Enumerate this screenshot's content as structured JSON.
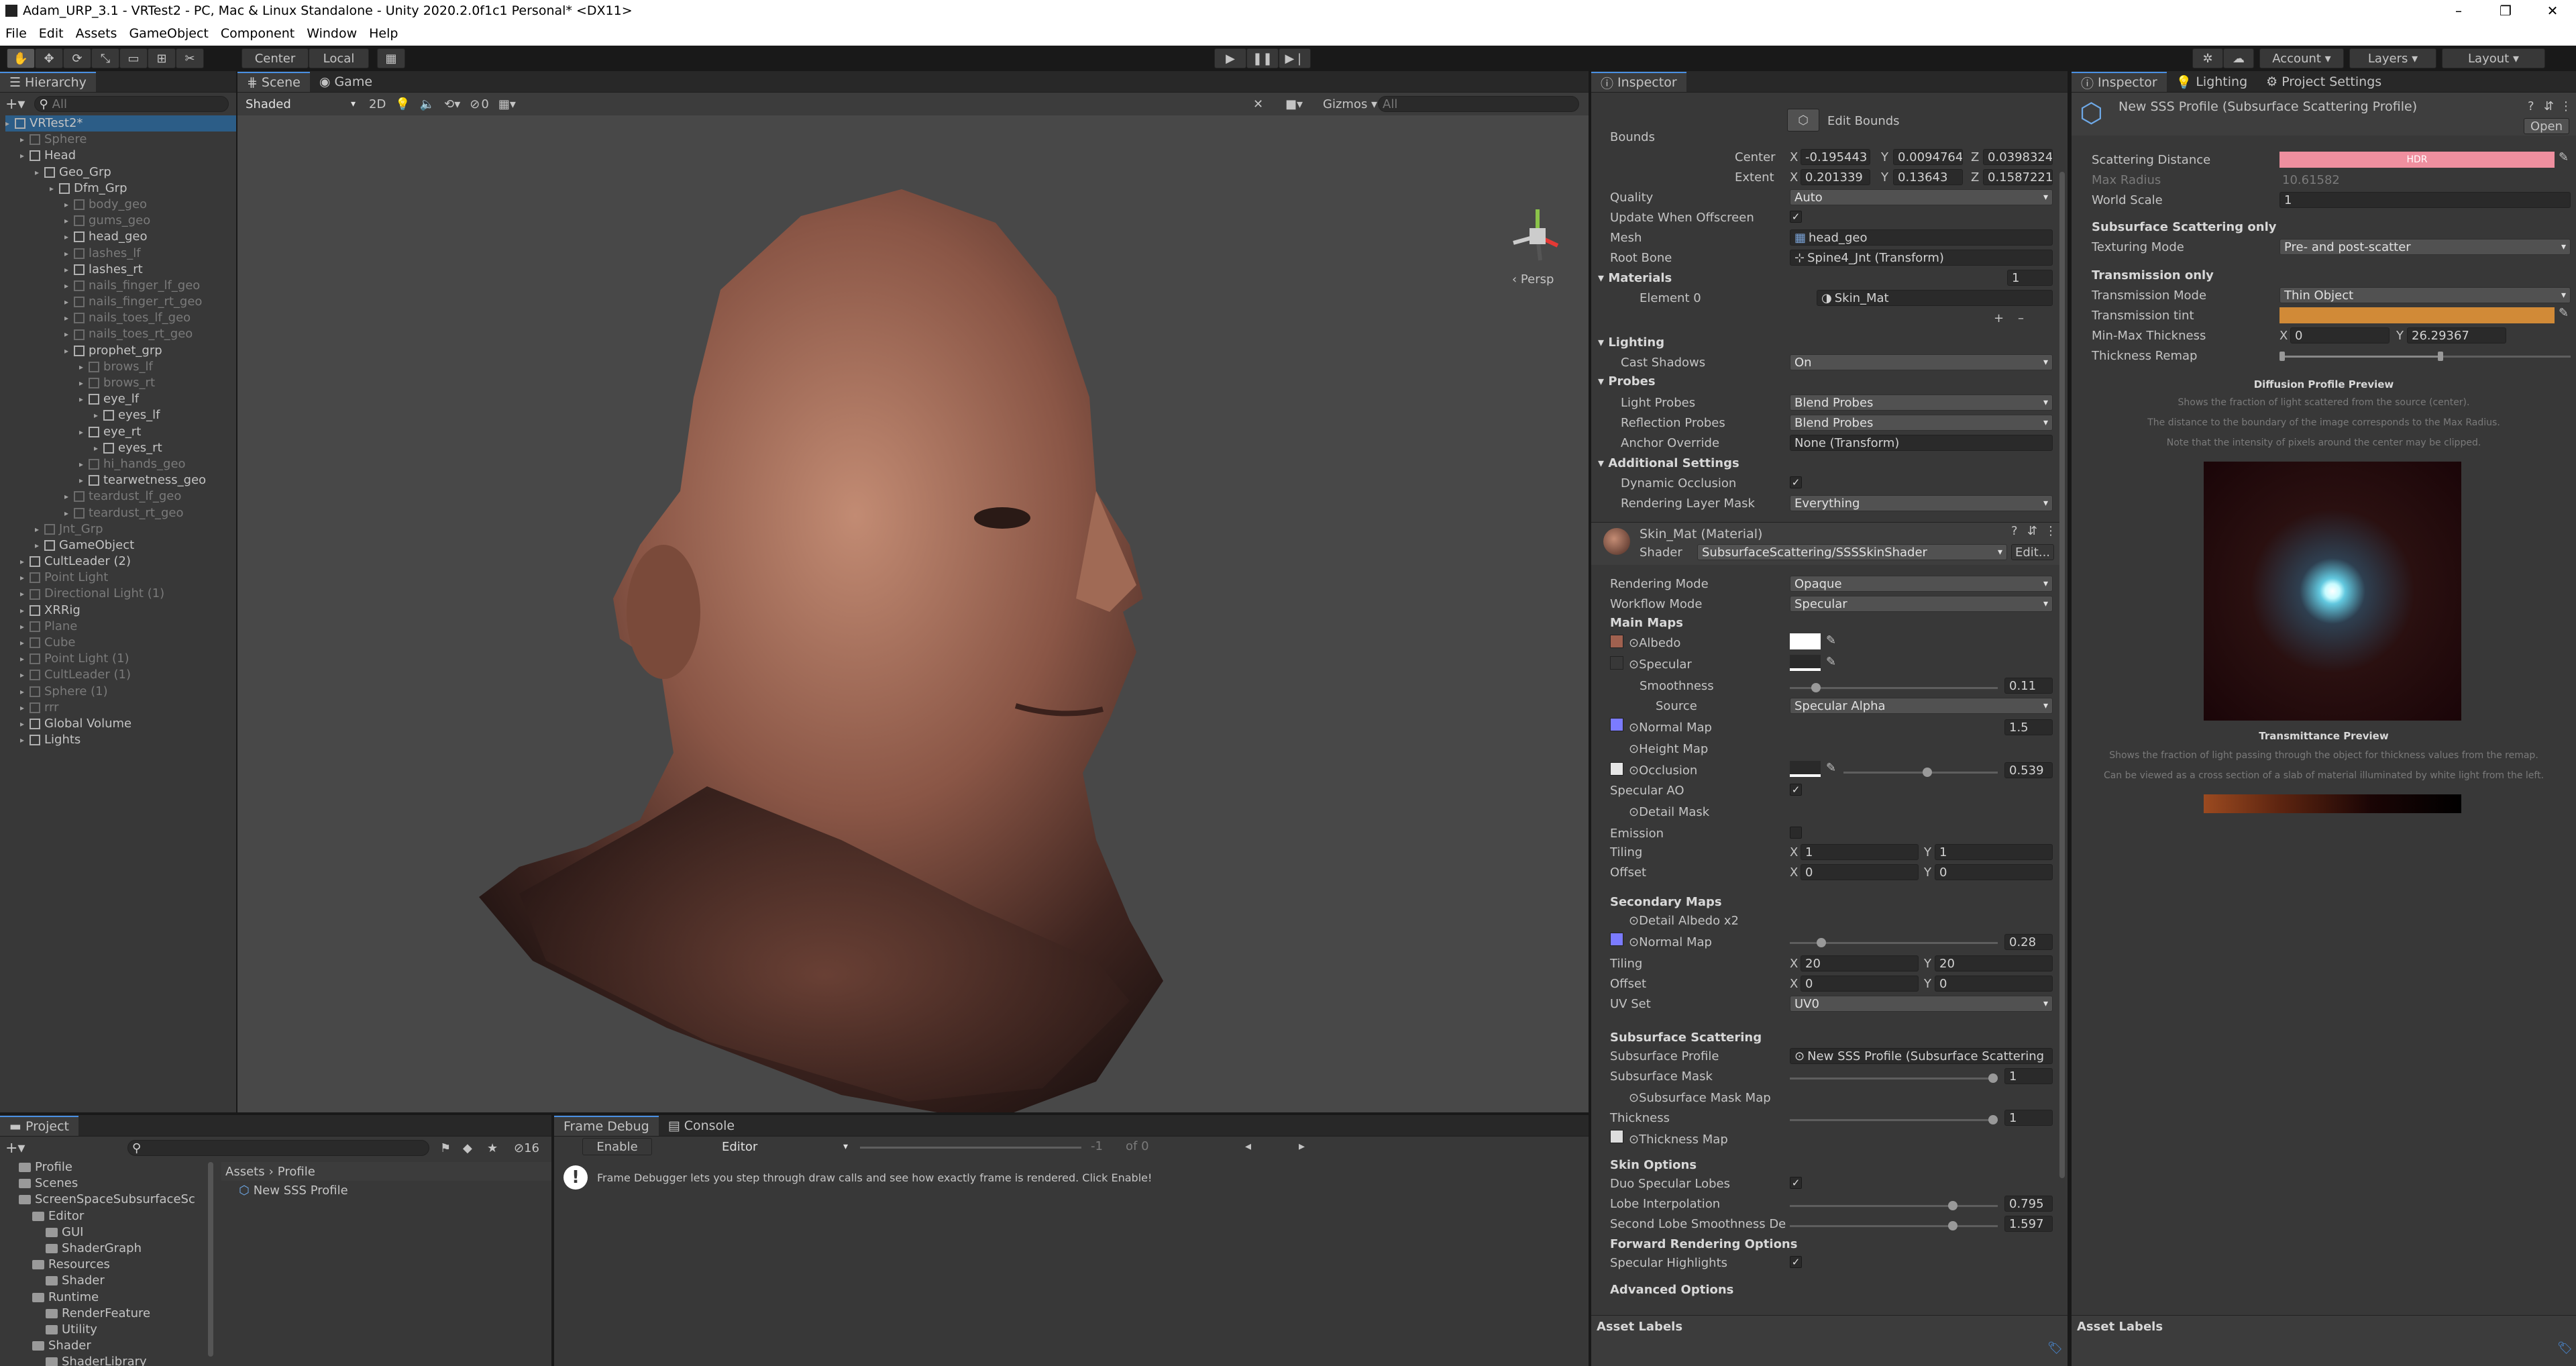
{
  "window": {
    "title": "Adam_URP_3.1 - VRTest2 - PC, Mac & Linux Standalone - Unity 2020.2.0f1c1 Personal* <DX11>"
  },
  "menu": [
    "File",
    "Edit",
    "Assets",
    "GameObject",
    "Component",
    "Window",
    "Help"
  ],
  "toolbar": {
    "pivot": "Center",
    "space": "Local",
    "account": "Account",
    "layers": "Layers",
    "layout": "Layout"
  },
  "hierarchy": {
    "tab": "Hierarchy",
    "search_placeholder": "All",
    "items": [
      {
        "label": "VRTest2*",
        "depth": 0,
        "dim": false
      },
      {
        "label": "Sphere",
        "depth": 1,
        "dim": true
      },
      {
        "label": "Head",
        "depth": 1,
        "dim": false
      },
      {
        "label": "Geo_Grp",
        "depth": 2,
        "dim": false
      },
      {
        "label": "Dfm_Grp",
        "depth": 3,
        "dim": false
      },
      {
        "label": "body_geo",
        "depth": 4,
        "dim": true
      },
      {
        "label": "gums_geo",
        "depth": 4,
        "dim": true
      },
      {
        "label": "head_geo",
        "depth": 4,
        "dim": false
      },
      {
        "label": "lashes_lf",
        "depth": 4,
        "dim": true
      },
      {
        "label": "lashes_rt",
        "depth": 4,
        "dim": false
      },
      {
        "label": "nails_finger_lf_geo",
        "depth": 4,
        "dim": true
      },
      {
        "label": "nails_finger_rt_geo",
        "depth": 4,
        "dim": true
      },
      {
        "label": "nails_toes_lf_geo",
        "depth": 4,
        "dim": true
      },
      {
        "label": "nails_toes_rt_geo",
        "depth": 4,
        "dim": true
      },
      {
        "label": "prophet_grp",
        "depth": 4,
        "dim": false
      },
      {
        "label": "brows_lf",
        "depth": 5,
        "dim": true
      },
      {
        "label": "brows_rt",
        "depth": 5,
        "dim": true
      },
      {
        "label": "eye_lf",
        "depth": 5,
        "dim": false
      },
      {
        "label": "eyes_lf",
        "depth": 6,
        "dim": false
      },
      {
        "label": "eye_rt",
        "depth": 5,
        "dim": false
      },
      {
        "label": "eyes_rt",
        "depth": 6,
        "dim": false
      },
      {
        "label": "hi_hands_geo",
        "depth": 5,
        "dim": true
      },
      {
        "label": "tearwetness_geo",
        "depth": 5,
        "dim": false
      },
      {
        "label": "teardust_lf_geo",
        "depth": 4,
        "dim": true
      },
      {
        "label": "teardust_rt_geo",
        "depth": 4,
        "dim": true
      },
      {
        "label": "Jnt_Grp",
        "depth": 2,
        "dim": true
      },
      {
        "label": "GameObject",
        "depth": 2,
        "dim": false
      },
      {
        "label": "CultLeader (2)",
        "depth": 1,
        "dim": false
      },
      {
        "label": "Point Light",
        "depth": 1,
        "dim": true
      },
      {
        "label": "Directional Light (1)",
        "depth": 1,
        "dim": true
      },
      {
        "label": "XRRig",
        "depth": 1,
        "dim": false
      },
      {
        "label": "Plane",
        "depth": 1,
        "dim": true
      },
      {
        "label": "Cube",
        "depth": 1,
        "dim": true
      },
      {
        "label": "Point Light (1)",
        "depth": 1,
        "dim": true
      },
      {
        "label": "CultLeader (1)",
        "depth": 1,
        "dim": true
      },
      {
        "label": "Sphere (1)",
        "depth": 1,
        "dim": true
      },
      {
        "label": "rrr",
        "depth": 1,
        "dim": true
      },
      {
        "label": "Global Volume",
        "depth": 1,
        "dim": false
      },
      {
        "label": "Lights",
        "depth": 1,
        "dim": false
      }
    ]
  },
  "scene": {
    "tabs": [
      "Scene",
      "Game"
    ],
    "shading": "Shaded",
    "mode_2d": "2D",
    "gizmos": "Gizmos",
    "search_placeholder": "All",
    "persp": "Persp",
    "effects_count": "0"
  },
  "inspector": {
    "tab": "Inspector",
    "edit_bounds": "Edit Bounds",
    "bounds": "Bounds",
    "center": {
      "label": "Center",
      "x": "-0.195443",
      "y": "0.0094764",
      "z": "0.0398324"
    },
    "extent": {
      "label": "Extent",
      "x": "0.201339",
      "y": "0.13643",
      "z": "0.1587221"
    },
    "quality": {
      "label": "Quality",
      "value": "Auto"
    },
    "update_offscreen": "Update When Offscreen",
    "mesh": {
      "label": "Mesh",
      "value": "head_geo"
    },
    "root_bone": {
      "label": "Root Bone",
      "value": "Spine4_Jnt (Transform)"
    },
    "materials": {
      "label": "Materials",
      "count": "1",
      "element": "Element 0",
      "value": "Skin_Mat"
    },
    "lighting": "Lighting",
    "cast_shadows": {
      "label": "Cast Shadows",
      "value": "On"
    },
    "probes": "Probes",
    "light_probes": {
      "label": "Light Probes",
      "value": "Blend Probes"
    },
    "reflection_probes": {
      "label": "Reflection Probes",
      "value": "Blend Probes"
    },
    "anchor": {
      "label": "Anchor Override",
      "value": "None (Transform)"
    },
    "additional": "Additional Settings",
    "dynamic_occlusion": "Dynamic Occlusion",
    "rendering_layer": {
      "label": "Rendering Layer Mask",
      "value": "Everything"
    },
    "material_name": "Skin_Mat (Material)",
    "shader": {
      "label": "Shader",
      "value": "SubsurfaceScattering/SSSSkinShader",
      "edit": "Edit..."
    },
    "rendering_mode": {
      "label": "Rendering Mode",
      "value": "Opaque"
    },
    "workflow_mode": {
      "label": "Workflow Mode",
      "value": "Specular"
    },
    "main_maps": "Main Maps",
    "albedo": "Albedo",
    "specular": "Specular",
    "smoothness": {
      "label": "Smoothness",
      "value": "0.11"
    },
    "source": {
      "label": "Source",
      "value": "Specular Alpha"
    },
    "normal_map": {
      "label": "Normal Map",
      "value": "1.5"
    },
    "height_map": "Height Map",
    "occlusion": {
      "label": "Occlusion",
      "value": "0.539"
    },
    "specular_ao": "Specular AO",
    "detail_mask": "Detail Mask",
    "emission": "Emission",
    "tiling": {
      "label": "Tiling",
      "x": "1",
      "y": "1"
    },
    "offset": {
      "label": "Offset",
      "x": "0",
      "y": "0"
    },
    "secondary_maps": "Secondary Maps",
    "detail_albedo": "Detail Albedo x2",
    "normal_map2": {
      "label": "Normal Map",
      "value": "0.28"
    },
    "tiling2": {
      "label": "Tiling",
      "x": "20",
      "y": "20"
    },
    "offset2": {
      "label": "Offset",
      "x": "0",
      "y": "0"
    },
    "uv_set": {
      "label": "UV Set",
      "value": "UV0"
    },
    "sss": "Subsurface Scattering",
    "sss_profile": {
      "label": "Subsurface Profile",
      "value": "New SSS Profile (Subsurface Scattering"
    },
    "sss_mask": {
      "label": "Subsurface Mask",
      "value": "1"
    },
    "sss_mask_map": "Subsurface Mask Map",
    "thickness": {
      "label": "Thickness",
      "value": "1"
    },
    "thickness_map": "Thickness Map",
    "skin_options": "Skin Options",
    "duo_specular": "Duo Specular Lobes",
    "lobe_interp": {
      "label": "Lobe Interpolation",
      "value": "0.795"
    },
    "second_lobe": {
      "label": "Second Lobe Smoothness Der",
      "value": "1.597"
    },
    "forward_opts": "Forward Rendering Options",
    "spec_highlights": "Specular Highlights",
    "advanced": "Advanced Options",
    "asset_labels": "Asset Labels"
  },
  "inspector2": {
    "tabs": [
      "Inspector",
      "Lighting",
      "Project Settings"
    ],
    "title": "New SSS Profile (Subsurface Scattering Profile)",
    "open": "Open",
    "scattering_distance": "Scattering Distance",
    "hdr": "HDR",
    "max_radius": {
      "label": "Max Radius",
      "value": "10.61582"
    },
    "world_scale": {
      "label": "World Scale",
      "value": "1"
    },
    "sss_only": "Subsurface Scattering only",
    "texturing_mode": {
      "label": "Texturing Mode",
      "value": "Pre- and post-scatter"
    },
    "transmission_only": "Transmission only",
    "transmission_mode": {
      "label": "Transmission Mode",
      "value": "Thin Object"
    },
    "transmission_tint": "Transmission tint",
    "minmax": {
      "label": "Min-Max Thickness",
      "x": "0",
      "y": "26.29367"
    },
    "thickness_remap": "Thickness Remap",
    "diffusion_title": "Diffusion Profile Preview",
    "diffusion_desc": [
      "Shows the fraction of light scattered from the source (center).",
      "The distance to the boundary of the image corresponds to the Max Radius.",
      "Note that the intensity of pixels around the center may be clipped."
    ],
    "transmittance_title": "Transmittance Preview",
    "transmittance_desc": [
      "Shows the fraction of light passing through the object for thickness values from the remap.",
      "Can be viewed as a cross section of a slab of material illuminated by white light from the left."
    ],
    "asset_labels": "Asset Labels"
  },
  "project": {
    "tab": "Project",
    "count": "16",
    "breadcrumb": [
      "Assets",
      "Profile"
    ],
    "asset": "New SSS Profile",
    "folders": [
      {
        "label": "Profile",
        "depth": 1
      },
      {
        "label": "Scenes",
        "depth": 1
      },
      {
        "label": "ScreenSpaceSubsurfaceSc",
        "depth": 1
      },
      {
        "label": "Editor",
        "depth": 2
      },
      {
        "label": "GUI",
        "depth": 3
      },
      {
        "label": "ShaderGraph",
        "depth": 3
      },
      {
        "label": "Resources",
        "depth": 2
      },
      {
        "label": "Shader",
        "depth": 3
      },
      {
        "label": "Runtime",
        "depth": 2
      },
      {
        "label": "RenderFeature",
        "depth": 3
      },
      {
        "label": "Utility",
        "depth": 3
      },
      {
        "label": "Shader",
        "depth": 2
      },
      {
        "label": "ShaderLibrary",
        "depth": 3
      }
    ]
  },
  "frame_debug": {
    "tabs": [
      "Frame Debug",
      "Console"
    ],
    "enable": "Enable",
    "editor": "Editor",
    "num": "-1",
    "of": "of 0",
    "message": "Frame Debugger lets you step through draw calls and see how exactly frame is rendered. Click Enable!"
  },
  "colors": {
    "accent": "#4a90e2",
    "scatter": "#ef8f9f",
    "tint": "#d18a37"
  }
}
